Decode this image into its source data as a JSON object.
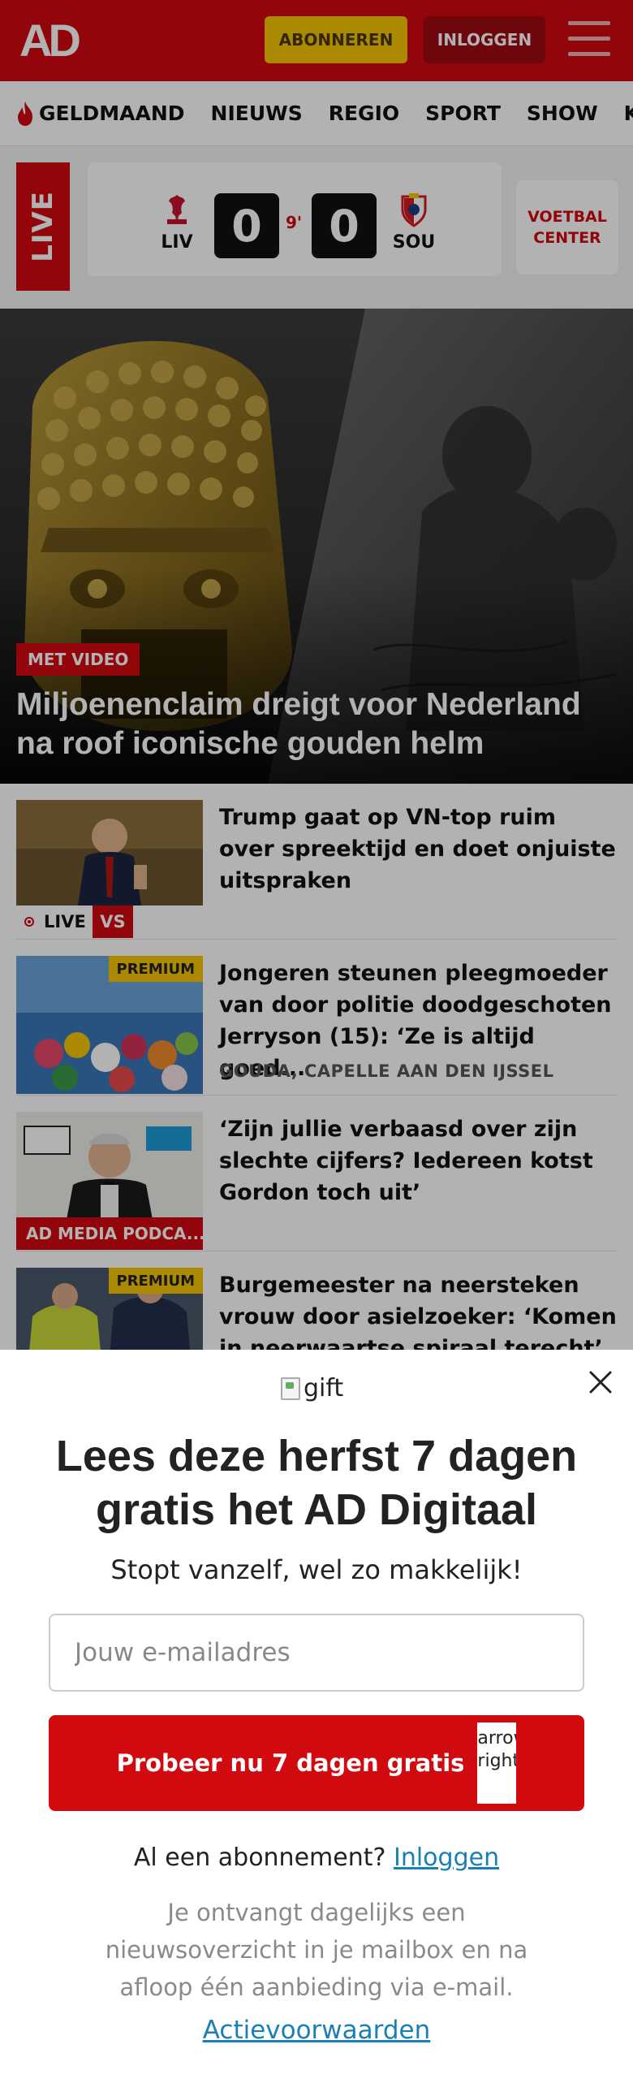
{
  "header": {
    "logo": "AD",
    "subscribe_label": "ABONNEREN",
    "login_label": "INLOGGEN"
  },
  "nav": {
    "items": [
      "GELDMAAND",
      "NIEUWS",
      "REGIO",
      "SPORT",
      "SHOW",
      "KIJK"
    ]
  },
  "live_match": {
    "tag": "LIVE",
    "home_team": "LIV",
    "away_team": "SOU",
    "home_score": "0",
    "away_score": "0",
    "minute": "9'",
    "voetbal_center": "VOETBAL CENTER"
  },
  "hero": {
    "badge": "MET VIDEO",
    "title": "Miljoenenclaim dreigt voor Nederland na roof iconische gouden helm"
  },
  "articles": [
    {
      "title": "Trump gaat op VN-top ruim over spreektijd en doet onjuiste uitspraken",
      "live_label": "LIVE",
      "vs_label": "VS"
    },
    {
      "title": "Jongeren steunen pleegmoeder van door politie doodgeschoten Jerryson (15): ‘Ze is altijd goed...",
      "meta": "GOUDA, CAPELLE AAN DEN IJSSEL",
      "premium": "PREMIUM"
    },
    {
      "title": "‘Zijn jullie verbaasd over zijn slechte cijfers? Iedereen kotst Gordon toch uit’",
      "category": "AD MEDIA PODCA..."
    },
    {
      "title": "Burgemeester na neersteken vrouw door asielzoeker: ‘Komen in neerwaartse spiraal terecht’",
      "premium": "PREMIUM"
    }
  ],
  "modal": {
    "gift_alt": "gift",
    "title": "Lees deze herfst 7 dagen gratis het AD Digitaal",
    "subtitle": "Stopt vanzelf, wel zo makkelijk!",
    "email_placeholder": "Jouw e-mailadres",
    "cta_label": "Probeer nu 7 dagen gratis",
    "cta_icon_alt": "arrow right",
    "have_subscription": "Al een abonnement?",
    "login_link": "Inloggen",
    "info": "Je ontvangt dagelijks een nieuwsoverzicht in je mailbox en na afloop één aanbieding via e-mail.",
    "terms": "Actievoorwaarden"
  },
  "colors": {
    "brand_red": "#d10a10",
    "premium_yellow": "#f5c400",
    "link_blue": "#1a7fb5"
  }
}
